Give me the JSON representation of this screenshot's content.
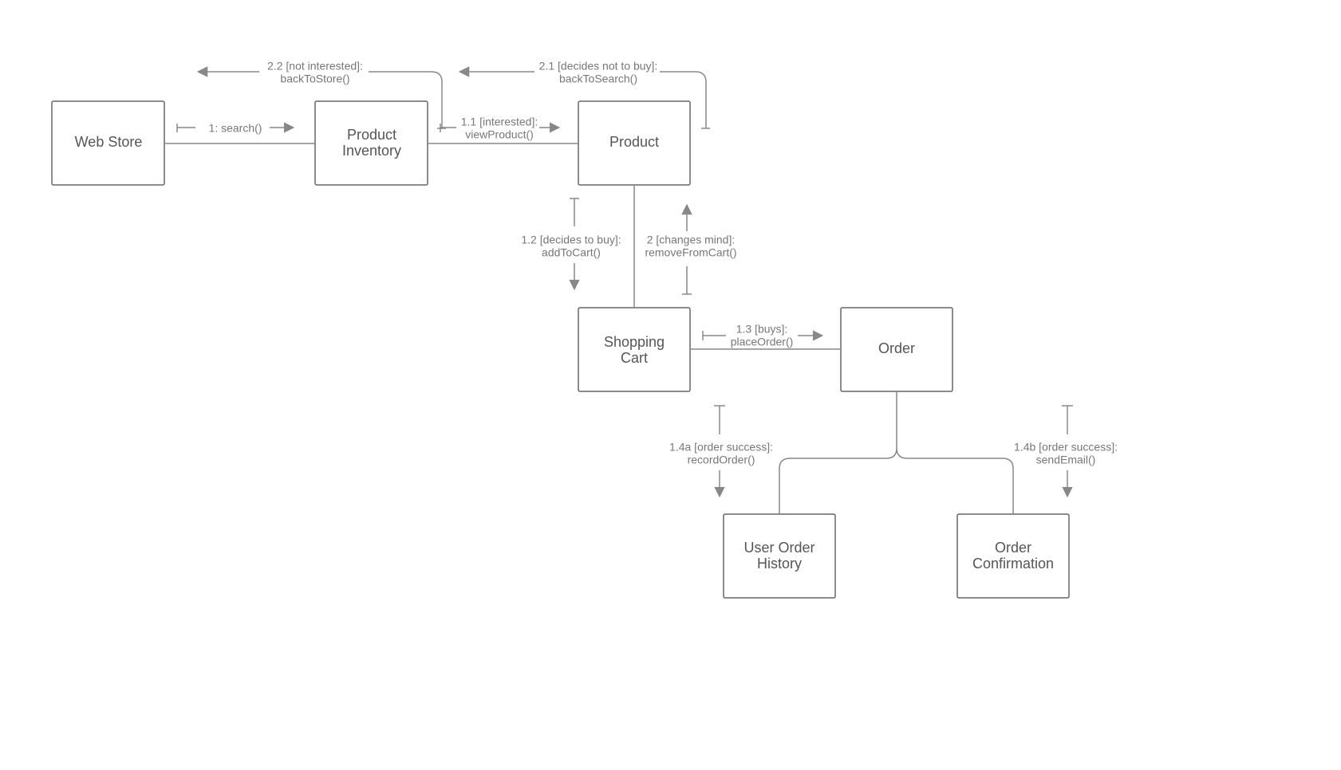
{
  "nodes": {
    "web_store": {
      "label": "Web Store"
    },
    "product_inventory": {
      "label1": "Product",
      "label2": "Inventory"
    },
    "product": {
      "label": "Product"
    },
    "shopping_cart": {
      "label1": "Shopping",
      "label2": "Cart"
    },
    "order": {
      "label": "Order"
    },
    "user_order_history": {
      "label1": "User Order",
      "label2": "History"
    },
    "order_confirmation": {
      "label1": "Order",
      "label2": "Confirmation"
    }
  },
  "edges": {
    "e_search": {
      "label": "1: search()"
    },
    "e_view_product": {
      "label1": "1.1 [interested]:",
      "label2": "viewProduct()"
    },
    "e_back_to_search": {
      "label1": "2.1 [decides not to buy]:",
      "label2": "backToSearch()"
    },
    "e_back_to_store": {
      "label1": "2.2 [not interested]:",
      "label2": "backToStore()"
    },
    "e_add_to_cart": {
      "label1": "1.2 [decides to buy]:",
      "label2": "addToCart()"
    },
    "e_remove_from_cart": {
      "label1": "2 [changes mind]:",
      "label2": "removeFromCart()"
    },
    "e_place_order": {
      "label1": "1.3 [buys]:",
      "label2": "placeOrder()"
    },
    "e_record_order": {
      "label1": "1.4a [order success]:",
      "label2": "recordOrder()"
    },
    "e_send_email": {
      "label1": "1.4b [order success]:",
      "label2": "sendEmail()"
    }
  }
}
